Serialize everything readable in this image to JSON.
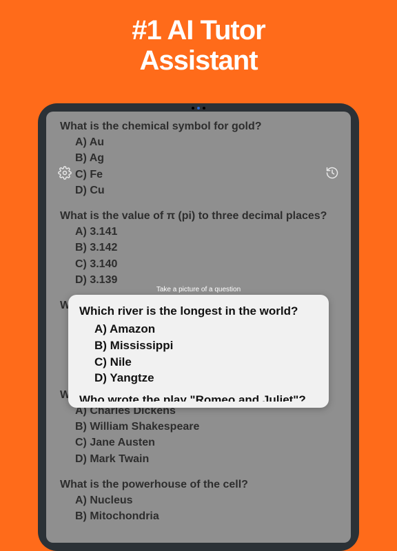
{
  "headline_line1": "#1 AI Tutor",
  "headline_line2": "Assistant",
  "overlay_hint": "Take a picture of a question",
  "background_questions": [
    {
      "prompt": "What is the chemical symbol for gold?",
      "options": [
        "A) Au",
        "B) Ag",
        "C) Fe",
        "D) Cu"
      ]
    },
    {
      "prompt": "What is the value of π (pi) to three decimal places?",
      "options": [
        "A) 3.141",
        "B) 3.142",
        "C) 3.140",
        "D) 3.139"
      ]
    },
    {
      "prompt": "Which river is the longest in the world?",
      "options": [
        "A) Amazon",
        "B) Mississippi",
        "C) Nile",
        "D) Yangtze"
      ]
    },
    {
      "prompt": "Who wrote the play \"Romeo and Juliet\"?",
      "options": [
        "A) Charles Dickens",
        "B) William Shakespeare",
        "C) Jane Austen",
        "D) Mark Twain"
      ]
    },
    {
      "prompt": "What is the powerhouse of the cell?",
      "options": [
        "A) Nucleus",
        "B) Mitochondria"
      ]
    }
  ],
  "capture": {
    "prompt": "Which river is the longest in the world?",
    "options": [
      "A) Amazon",
      "B) Mississippi",
      "C) Nile",
      "D) Yangtze"
    ],
    "peek_next": "Who wrote the play \"Romeo and Juliet\"?"
  },
  "icons": {
    "settings": "gear-icon",
    "history": "history-icon"
  }
}
